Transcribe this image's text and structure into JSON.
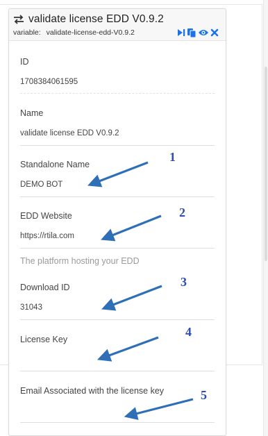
{
  "panel": {
    "title": "validate license EDD V0.9.2",
    "variable_label": "variable:",
    "variable_value": "validate-license-edd-V0.9.2",
    "icons": [
      "swap-icon",
      "run-icon",
      "copy-icon",
      "eye-icon",
      "close-icon"
    ],
    "accent": "#1a73e8"
  },
  "fields": [
    {
      "label": "ID",
      "value": "1708384061595"
    },
    {
      "label": "Name",
      "value": "validate license EDD V0.9.2"
    },
    {
      "label": "Standalone Name",
      "value": "DEMO BOT"
    },
    {
      "label": "EDD Website",
      "value": "https://rtila.com",
      "help": "The platform hosting your EDD"
    },
    {
      "label": "Download ID",
      "value": "31043"
    },
    {
      "label": "License Key",
      "value": ""
    },
    {
      "label": "Email Associated with the license key",
      "value": ""
    }
  ],
  "annotations": [
    "1",
    "2",
    "3",
    "4",
    "5"
  ],
  "annotation_color": "#2e6fb8"
}
